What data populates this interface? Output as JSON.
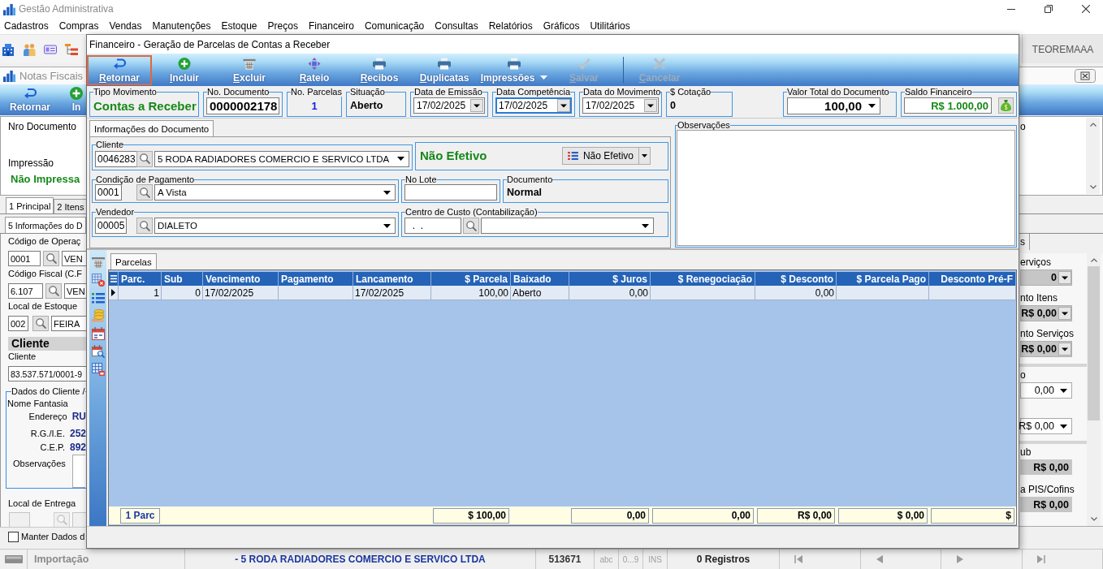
{
  "app_window": {
    "title": "Gestão Administrativa",
    "menu": [
      "Cadastros",
      "Compras",
      "Vendas",
      "Manutenções",
      "Estoque",
      "Preços",
      "Financeiro",
      "Comunicação",
      "Consultas",
      "Relatórios",
      "Gráficos",
      "Utilitários"
    ],
    "user": "TEOREMAAA"
  },
  "invoice_window": {
    "title": "Notas Fiscais",
    "toolbar": [
      {
        "label": "Retornar",
        "kind": "return"
      },
      {
        "label": "In",
        "kind": "add"
      }
    ],
    "document_label": "Nro Documento",
    "print_label": "Impressão",
    "print_status": "Não Impressa",
    "tabs": [
      {
        "label": "1 Principal",
        "selected": true
      },
      {
        "label": "2 Itens",
        "selected": false
      }
    ],
    "subtabs": [
      {
        "label": "5 Informações do D",
        "selected": true
      }
    ],
    "lookups": [
      {
        "label": "Código de Operaç",
        "code": "0001",
        "description": "VEN"
      },
      {
        "label": "Código Fiscal (C.F",
        "code": "6.107",
        "description": "VEN"
      },
      {
        "label": "Local de Estoque",
        "code": "002",
        "description": "FEIRA"
      }
    ],
    "client_section": {
      "title": "Cliente",
      "label": "Cliente",
      "value": "83.537.571/0001-9"
    },
    "client_data": {
      "title": "Dados do Cliente /",
      "trade_name_label": "Nome Fantasia",
      "rows": [
        {
          "label": "Endereço",
          "value": "RU"
        },
        {
          "label": "R.G./I.E.",
          "value": "252"
        },
        {
          "label": "C.E.P.",
          "value": "892"
        }
      ],
      "notes_label": "Observações"
    },
    "delivery": {
      "label": "Local de Entrega",
      "disabled": true
    },
    "keep_data": {
      "label": "Manter Dados d",
      "checked": false
    },
    "top_right_text": "o",
    "tab_right_text": "s",
    "summary_groups": [
      {
        "fields": [
          {
            "label": "erviços",
            "value": "0",
            "kind": "readonly-dropdown"
          },
          {
            "label": "nto Itens",
            "value": "R$ 0,00",
            "kind": "readonly-dropdown"
          },
          {
            "label": "nto Serviços",
            "value": "R$ 0,00",
            "kind": "readonly-dropdown"
          }
        ]
      },
      {
        "fields": [
          {
            "label": "o",
            "value": "0,00",
            "kind": "dropdown"
          },
          {
            "value": "R$ 0,00",
            "kind": "dropdown"
          }
        ]
      },
      {
        "fields": [
          {
            "label": "ub",
            "value": "R$ 0,00",
            "kind": "total"
          },
          {
            "label": "a PIS/Cofins",
            "value": "R$ 0,00",
            "kind": "total"
          }
        ]
      }
    ]
  },
  "dialog": {
    "title": "Financeiro - Geração de Parcelas de Contas a Receber",
    "toolbar_groups": [
      {
        "buttons": [
          {
            "label": "Retornar",
            "kind": "return",
            "highlighted": true,
            "disabled": false,
            "has_menu": false
          },
          {
            "label": "Incluir",
            "kind": "add",
            "highlighted": false,
            "disabled": false,
            "has_menu": false
          },
          {
            "label": "Excluir",
            "kind": "delete",
            "highlighted": false,
            "disabled": false,
            "has_menu": false
          },
          {
            "label": "Rateio",
            "kind": "move",
            "highlighted": false,
            "disabled": false,
            "has_menu": false
          },
          {
            "label": "Recibos",
            "kind": "print",
            "highlighted": false,
            "disabled": false,
            "has_menu": false
          },
          {
            "label": "Duplicatas",
            "kind": "print",
            "highlighted": false,
            "disabled": false,
            "has_menu": false
          },
          {
            "label": "Impressões",
            "kind": "print",
            "highlighted": false,
            "disabled": false,
            "has_menu": true
          },
          {
            "label": "Salvar",
            "kind": "save",
            "highlighted": false,
            "disabled": true,
            "has_menu": false
          }
        ]
      },
      {
        "buttons": [
          {
            "label": "Cancelar",
            "kind": "cancel",
            "highlighted": false,
            "disabled": true,
            "has_menu": false
          }
        ]
      }
    ],
    "header": [
      {
        "kind": "status",
        "label": "Tipo Movimento",
        "value": "Contas a Receber"
      },
      {
        "kind": "input",
        "label": "No. Documento",
        "value": "0000002178"
      },
      {
        "kind": "count",
        "label": "No. Parcelas",
        "value": "1"
      },
      {
        "kind": "text",
        "label": "Situação",
        "value": "Aberto"
      },
      {
        "kind": "date",
        "label": "Data de Emissão",
        "value": "17/02/2025",
        "focused": false
      },
      {
        "kind": "date",
        "label": "Data Competência",
        "value": "17/02/2025",
        "focused": true
      },
      {
        "kind": "date",
        "label": "Data do Movimento",
        "value": "17/02/2025",
        "focused": false
      },
      {
        "kind": "text",
        "label": "$ Cotação",
        "value": "0"
      },
      {
        "kind": "amount",
        "label": "Valor Total do Documento",
        "value": "100,00"
      },
      {
        "kind": "balance",
        "label": "Saldo Financeiro",
        "value": "R$ 1.000,00"
      }
    ],
    "document_tabs": [
      {
        "label": "Informações do Documento",
        "selected": true
      }
    ],
    "client": {
      "label": "Cliente",
      "code": "0046283",
      "name": "5 RODA RADIADORES COMERCIO E SERVICO LTDA"
    },
    "effective": {
      "status": "Não Efetivo",
      "button": "Não Efetivo"
    },
    "payment_terms": {
      "label": "Condição de Pagamento",
      "code": "0001",
      "name": "A Vista"
    },
    "batch": {
      "label": "No Lote"
    },
    "document_type": {
      "label": "Documento",
      "value": "Normal"
    },
    "seller": {
      "label": "Vendedor",
      "code": "00005",
      "name": "DIALETO"
    },
    "cost_center": {
      "label": "Centro de Custo (Contabilização)",
      "code": "  .  ."
    },
    "notes": {
      "label": "Observações"
    },
    "installments": {
      "tabs": [
        {
          "label": "Parcelas",
          "selected": true
        }
      ],
      "columns": [
        "Parc.",
        "Sub",
        "Vencimento",
        "Pagamento",
        "Lancamento",
        "$ Parcela",
        "Baixado",
        "$ Juros",
        "$ Renegociação",
        "$ Desconto",
        "$ Parcela Pago",
        "Desconto Pré-F"
      ],
      "rows": [
        {
          "selected": true,
          "parc": "1",
          "sub": "0",
          "vencimento": "17/02/2025",
          "lancamento": "17/02/2025",
          "parcela": "100,00",
          "baixado": "Aberto",
          "juros": "0,00",
          "desconto": "0,00"
        }
      ],
      "totals": {
        "parc": "1 Parc",
        "parcela": "$ 100,00",
        "juros": "0,00",
        "renegociacao": "0,00",
        "desconto": "R$ 0,00",
        "parcela_pago": "$ 0,00",
        "desconto_pre": "$"
      }
    }
  },
  "status_bar": {
    "mode": "Importação",
    "customer": "- 5 RODA RADIADORES COMERCIO E SERVICO LTDA",
    "code": "513671",
    "indicators": [
      "abc",
      "0...9",
      "INS"
    ],
    "records": "0 Registros"
  }
}
